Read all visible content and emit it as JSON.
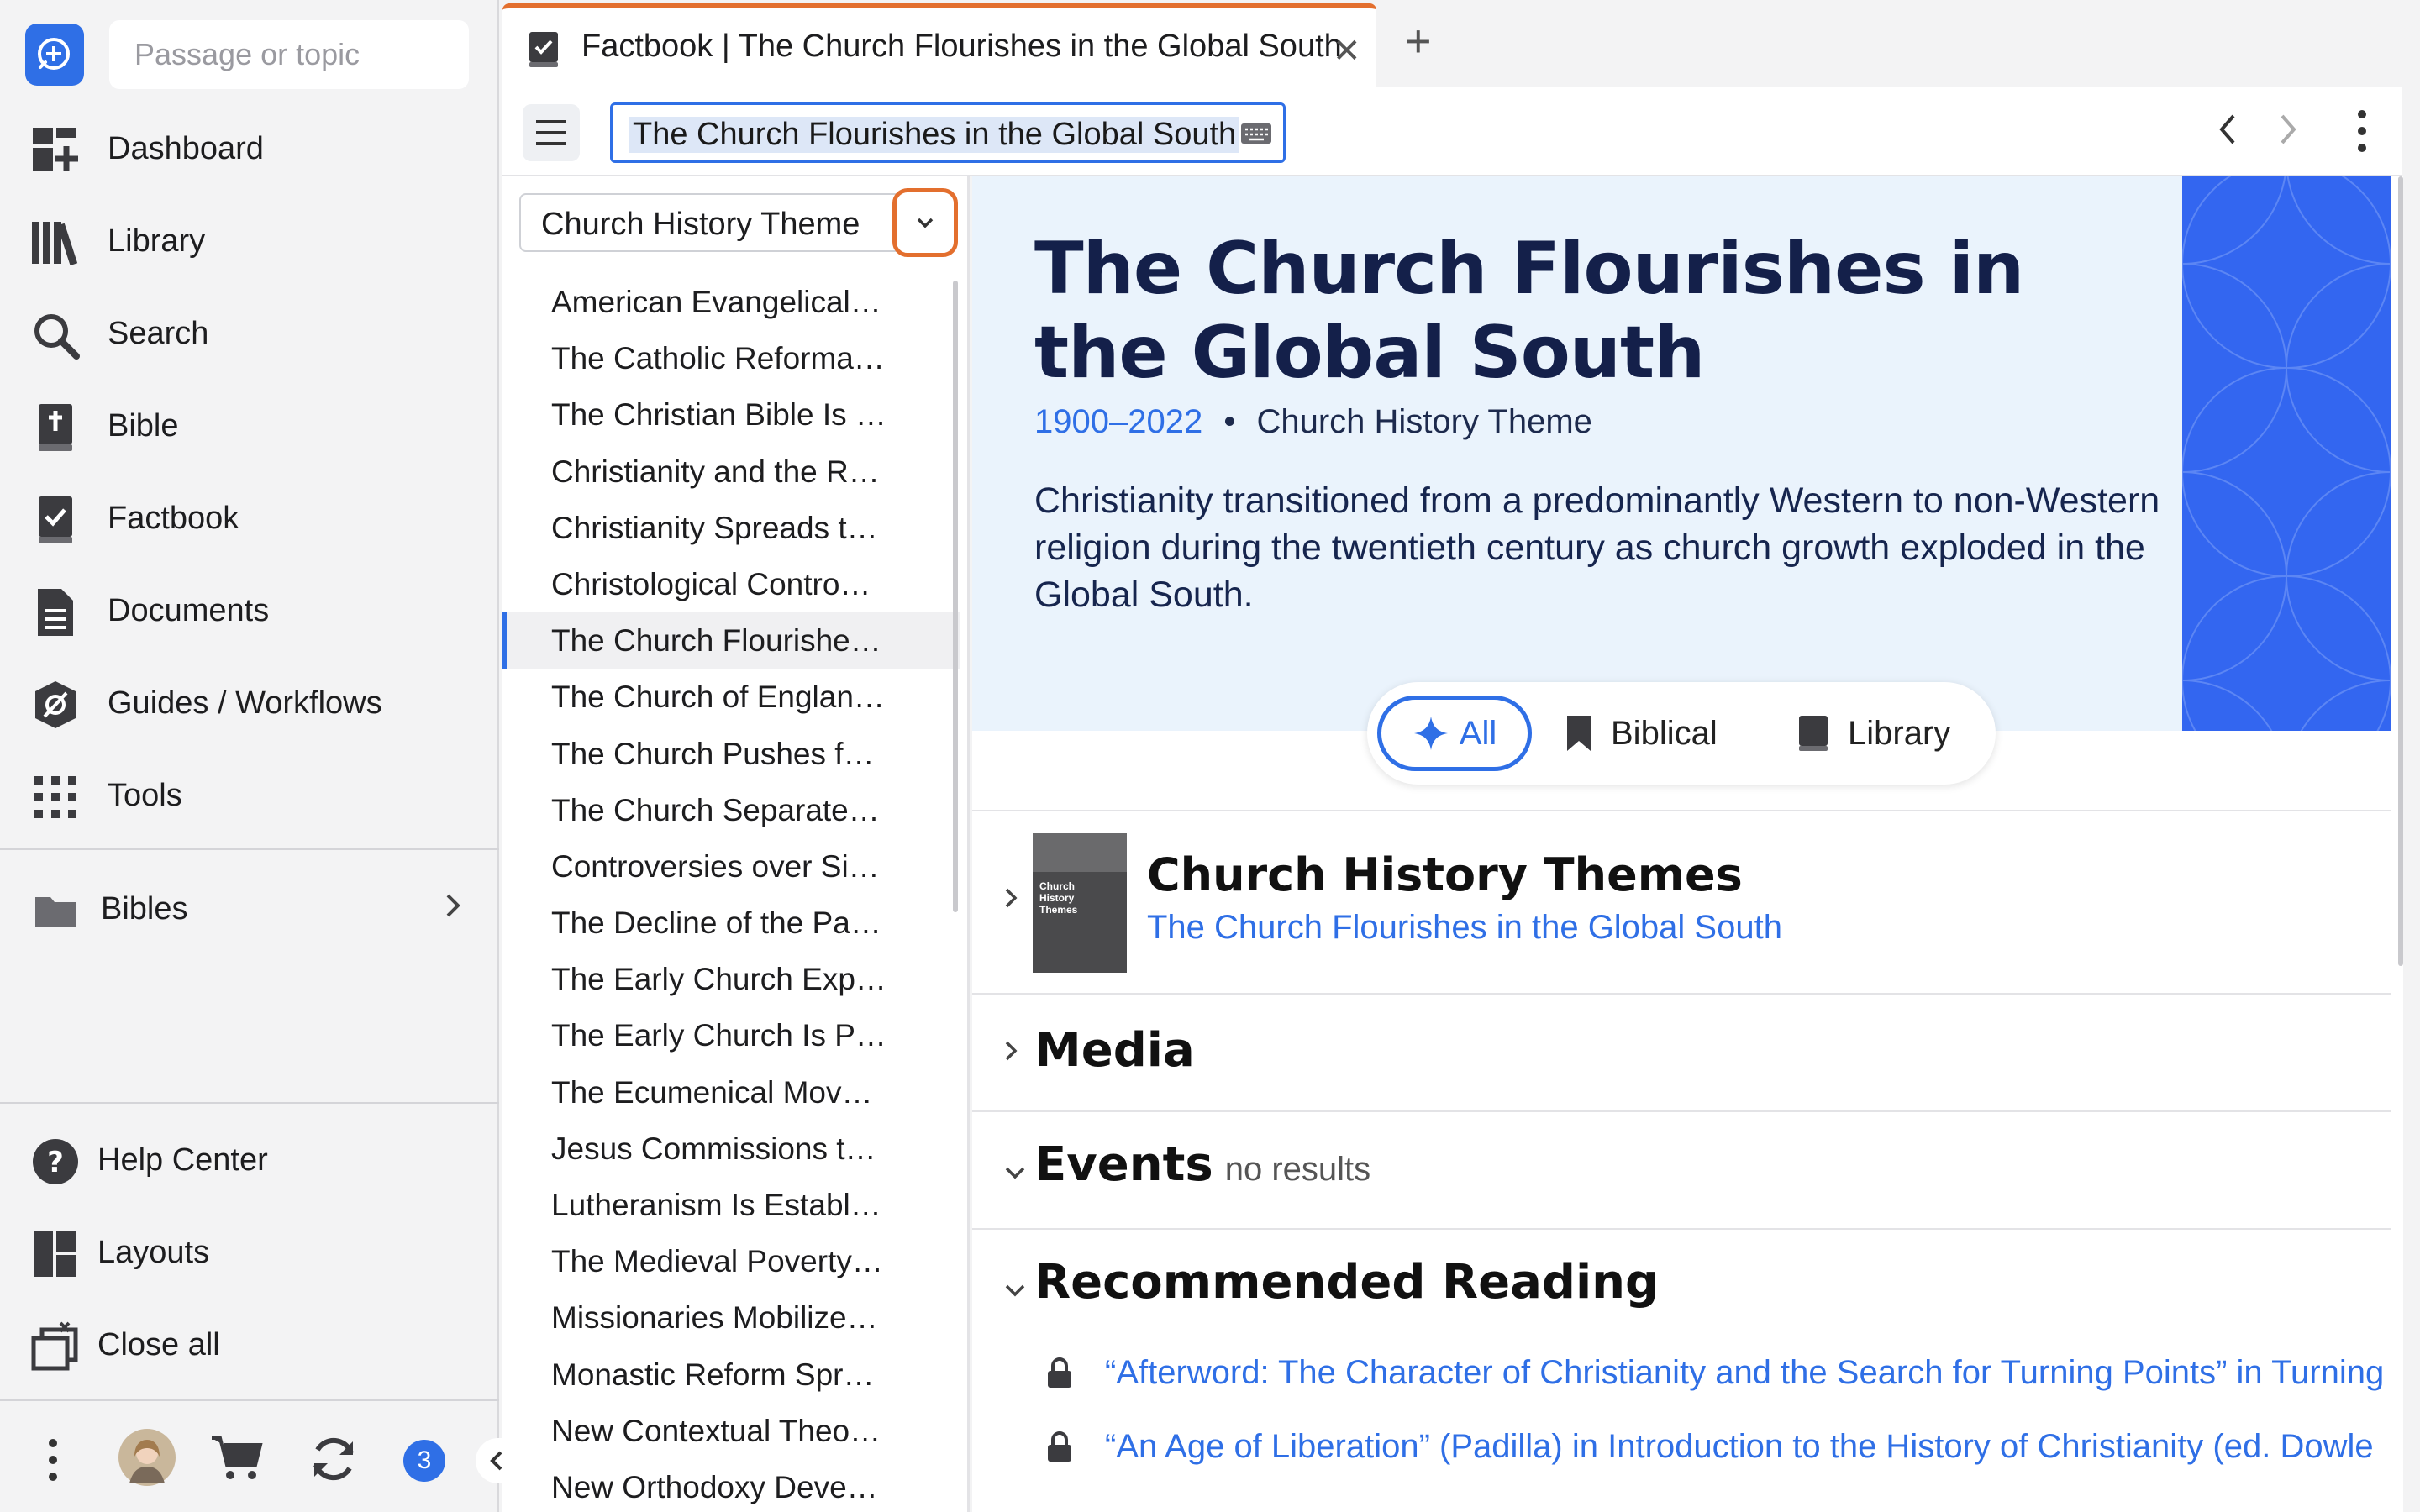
{
  "search": {
    "placeholder": "Passage or topic"
  },
  "nav": {
    "items": [
      {
        "label": "Dashboard",
        "icon": "dashboard-icon"
      },
      {
        "label": "Library",
        "icon": "library-icon"
      },
      {
        "label": "Search",
        "icon": "search-icon"
      },
      {
        "label": "Bible",
        "icon": "bible-icon"
      },
      {
        "label": "Factbook",
        "icon": "factbook-icon"
      },
      {
        "label": "Documents",
        "icon": "documents-icon"
      },
      {
        "label": "Guides / Workflows",
        "icon": "guides-icon"
      },
      {
        "label": "Tools",
        "icon": "tools-icon"
      }
    ],
    "bibles_label": "Bibles",
    "bottom_items": [
      {
        "label": "Help Center",
        "icon": "help-icon"
      },
      {
        "label": "Layouts",
        "icon": "layouts-icon"
      },
      {
        "label": "Close all",
        "icon": "close-all-icon"
      }
    ],
    "notification_count": "3"
  },
  "tab": {
    "title": "Factbook | The Church Flourishes in the Global South",
    "close_symbol": "✕",
    "new_symbol": "+"
  },
  "toolbar": {
    "title_value": "The Church Flourishes in the Global South"
  },
  "list": {
    "theme": "Church History Theme",
    "items": [
      "American Evangelical…",
      "The Catholic Reforma…",
      "The Christian Bible Is …",
      "Christianity and the R…",
      "Christianity Spreads t…",
      "Christological Contro…",
      "The Church Flourishe…",
      "The Church of Englan…",
      "The Church Pushes f…",
      "The Church Separate…",
      "Controversies over Si…",
      "The Decline of the Pa…",
      "The Early Church Exp…",
      "The Early Church Is P…",
      "The Ecumenical Mov…",
      "Jesus Commissions t…",
      "Lutheranism Is Establ…",
      "The Medieval Poverty…",
      "Missionaries Mobilize…",
      "Monastic Reform Spr…",
      "New Contextual Theo…",
      "New Orthodoxy Deve…"
    ],
    "selected_index": 6
  },
  "article": {
    "title": "The Church Flourishes in the Global South",
    "dates": "1900–2022",
    "bullet": "•",
    "theme": "Church History Theme",
    "description": "Christianity transitioned from a predominantly Western to non-Western religion during the twentieth century as church growth exploded in the Global South.",
    "filters": {
      "all": "All",
      "biblical": "Biblical",
      "library": "Library"
    }
  },
  "sections": {
    "book": {
      "cover_text": "Church History Themes",
      "title": "Church History Themes",
      "subtitle": "The Church Flourishes in the Global South"
    },
    "media": {
      "title": "Media"
    },
    "events": {
      "title": "Events",
      "status": "no results"
    },
    "reading": {
      "title": "Recommended Reading",
      "items": [
        "“Afterword: The Character of Christianity and the Search for Turning Points” in Turning",
        "“An Age of Liberation” (Padilla) in Introduction to the History of Christianity (ed. Dowle"
      ]
    }
  },
  "colors": {
    "accent": "#2f6fe6",
    "highlight": "#e36f2e",
    "hero_bg": "#eaf3fc",
    "hero_art": "#3366f0",
    "title_navy": "#14204a"
  }
}
